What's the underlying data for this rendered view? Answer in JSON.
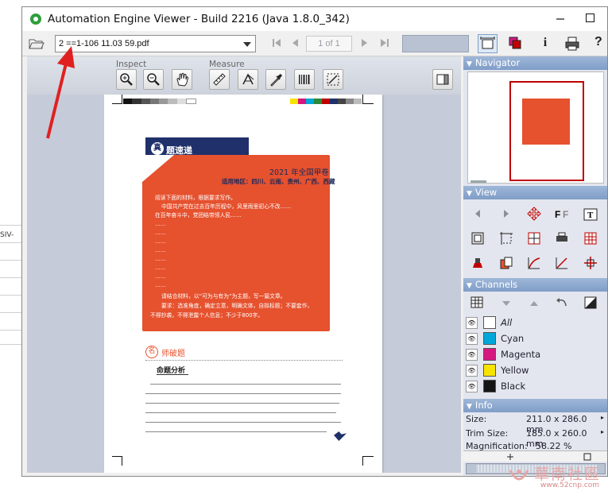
{
  "window": {
    "title": "Automation Engine Viewer - Build 2216 (Java 1.8.0_342)"
  },
  "background": {
    "left_fragment": "SIV-"
  },
  "toolbar": {
    "file_name": "2 ==1-106 11.03 59.pdf",
    "page_indicator": "1 of 1",
    "info_label": "i",
    "help_label": "?"
  },
  "view_toolbar": {
    "inspect_label": "Inspect",
    "measure_label": "Measure"
  },
  "page_content": {
    "tab_title": "题速递",
    "tab_badge": "真",
    "exam_title": "2021 年全国甲卷",
    "exam_region": "适用地区：四川、云南、贵州、广西、西藏",
    "lines": [
      "阅读下面的材料，根据要求写作。",
      "中国共产党在过去百年历程中，风里雨里初心不改……",
      "在百年奋斗中，党团结带领人民……",
      "……",
      "……",
      "……",
      "……",
      "……",
      "……",
      "……",
      "……",
      "请结合材料，以“可为与有为”为主题，写一篇文章。",
      "要求：选准角度，确定立意，明确文体，自拟标题；不要套作，",
      "不得抄袭，不得泄露个人信息；不少于800字。"
    ],
    "section_badge": "名",
    "section_title": "师破题",
    "sub_title": "命题分析"
  },
  "panels": {
    "navigator": "Navigator",
    "view": "View",
    "channels": "Channels",
    "info": "Info"
  },
  "channels": [
    {
      "name": "All",
      "color": "#ffffff",
      "italic": true
    },
    {
      "name": "Cyan",
      "color": "#00a7d8"
    },
    {
      "name": "Magenta",
      "color": "#d6177f"
    },
    {
      "name": "Yellow",
      "color": "#f7e300"
    },
    {
      "name": "Black",
      "color": "#151515"
    }
  ],
  "info": {
    "size_label": "Size:",
    "size_value": "211.0 x 286.0 mm",
    "trim_label": "Trim Size:",
    "trim_value": "185.0 x 260.0 mm",
    "mag_label": "Magnification:",
    "mag_value": "58.22 %"
  },
  "watermark": {
    "text": "華南社區",
    "url": "www.52cnp.com"
  },
  "colors": {
    "accent_orange": "#e6512e",
    "navy": "#20306a",
    "panel_header": "#8aa5cf",
    "arrow_red": "#e02020"
  }
}
